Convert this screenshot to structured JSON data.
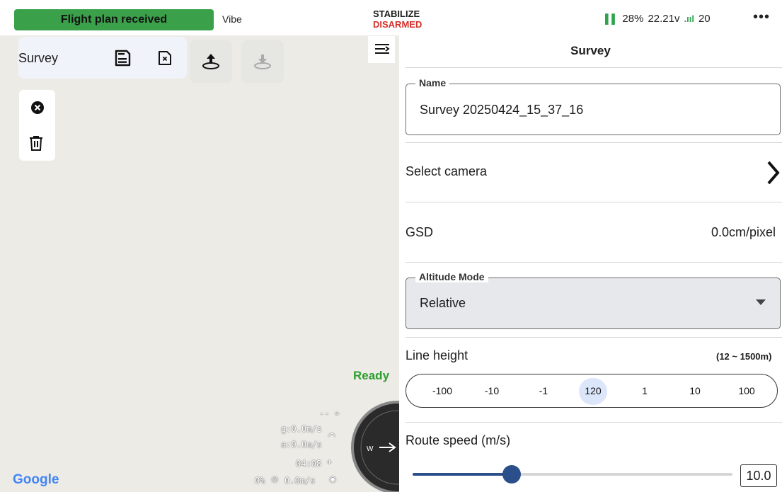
{
  "topbar": {
    "status": "Flight plan received",
    "vehicle": "Vibe",
    "flight_mode": "STABILIZE",
    "arm_state": "DISARMED",
    "battery": "28%",
    "voltage": "22.21v",
    "satellites": "20",
    "colors": {
      "status_bg": "#3aa14a",
      "disarmed": "#d4302a"
    }
  },
  "map": {
    "mission_type": "Survey",
    "status": "Ready",
    "attribution": "Google",
    "hud": {
      "distance": "--",
      "ground_speed": "g:0.0m/s",
      "air_speed": "a:0.0m/s",
      "flight_time": "04:08",
      "throttle": "0%",
      "climb_rate": "0.0m/s"
    },
    "toolbar_icons": [
      "save-icon",
      "close-file-icon",
      "upload-icon",
      "download-icon",
      "cancel-icon",
      "trash-icon"
    ]
  },
  "panel": {
    "title": "Survey",
    "name_label": "Name",
    "name_value": "Survey 20250424_15_37_16",
    "select_camera": "Select camera",
    "gsd_label": "GSD",
    "gsd_value": "0.0cm/pixel",
    "altitude_mode_label": "Altitude Mode",
    "altitude_mode_value": "Relative",
    "line_height_label": "Line height",
    "line_height_range": "(12 ~ 1500m)",
    "line_height_steps": [
      "-100",
      "-10",
      "-1",
      "120",
      "1",
      "10",
      "100"
    ],
    "line_height_value": 120,
    "route_speed_label": "Route speed (m/s)",
    "route_speed_value": "10.0",
    "route_speed_fraction": 0.31
  }
}
